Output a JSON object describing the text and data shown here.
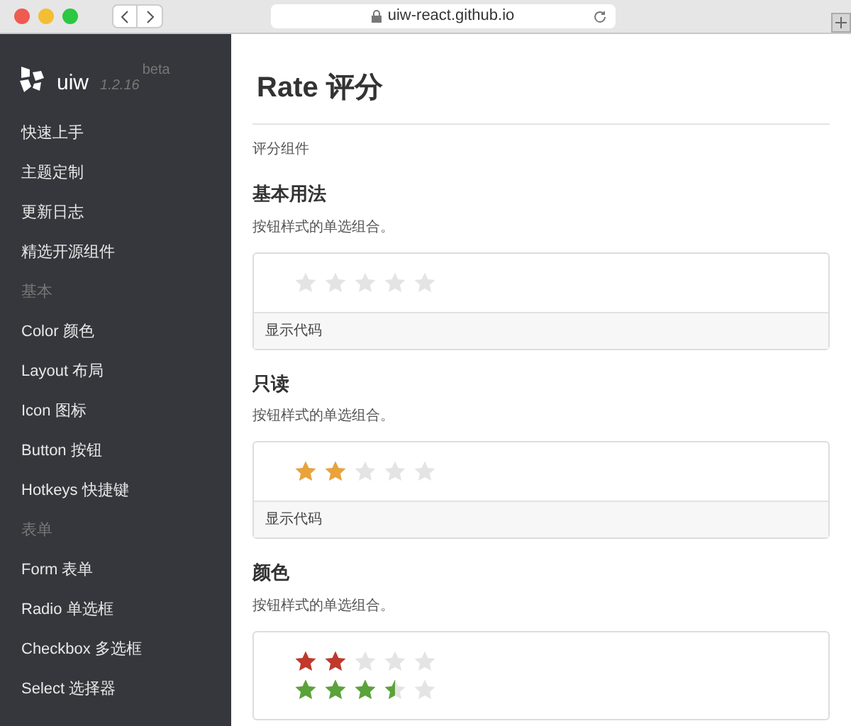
{
  "browser": {
    "url": "uiw-react.github.io"
  },
  "sidebar": {
    "logo": "uiw",
    "version": "1.2.16",
    "badge": "beta",
    "items": [
      {
        "kind": "link",
        "label": "快速上手"
      },
      {
        "kind": "link",
        "label": "主题定制"
      },
      {
        "kind": "link",
        "label": "更新日志"
      },
      {
        "kind": "link",
        "label": "精选开源组件"
      },
      {
        "kind": "group",
        "label": "基本"
      },
      {
        "kind": "link",
        "label": "Color 颜色"
      },
      {
        "kind": "link",
        "label": "Layout 布局"
      },
      {
        "kind": "link",
        "label": "Icon 图标"
      },
      {
        "kind": "link",
        "label": "Button 按钮"
      },
      {
        "kind": "link",
        "label": "Hotkeys 快捷键"
      },
      {
        "kind": "group",
        "label": "表单"
      },
      {
        "kind": "link",
        "label": "Form 表单"
      },
      {
        "kind": "link",
        "label": "Radio 单选框"
      },
      {
        "kind": "link",
        "label": "Checkbox 多选框"
      },
      {
        "kind": "link",
        "label": "Select 选择器"
      }
    ]
  },
  "page": {
    "title": "Rate 评分",
    "subtitle": "评分组件",
    "sections": [
      {
        "heading": "基本用法",
        "description": "按钮样式的单选组合。",
        "rates": [
          {
            "stars": 0
          }
        ],
        "code_toggle": "显示代码"
      },
      {
        "heading": "只读",
        "description": "按钮样式的单选组合。",
        "rates": [
          {
            "stars": 2,
            "color": "#e8a33d"
          }
        ],
        "code_toggle": "显示代码"
      },
      {
        "heading": "颜色",
        "description": "按钮样式的单选组合。",
        "rates": [
          {
            "stars": 2,
            "color": "#c0392b"
          },
          {
            "stars": 3.5,
            "color": "#5aa23a"
          }
        ]
      }
    ]
  }
}
